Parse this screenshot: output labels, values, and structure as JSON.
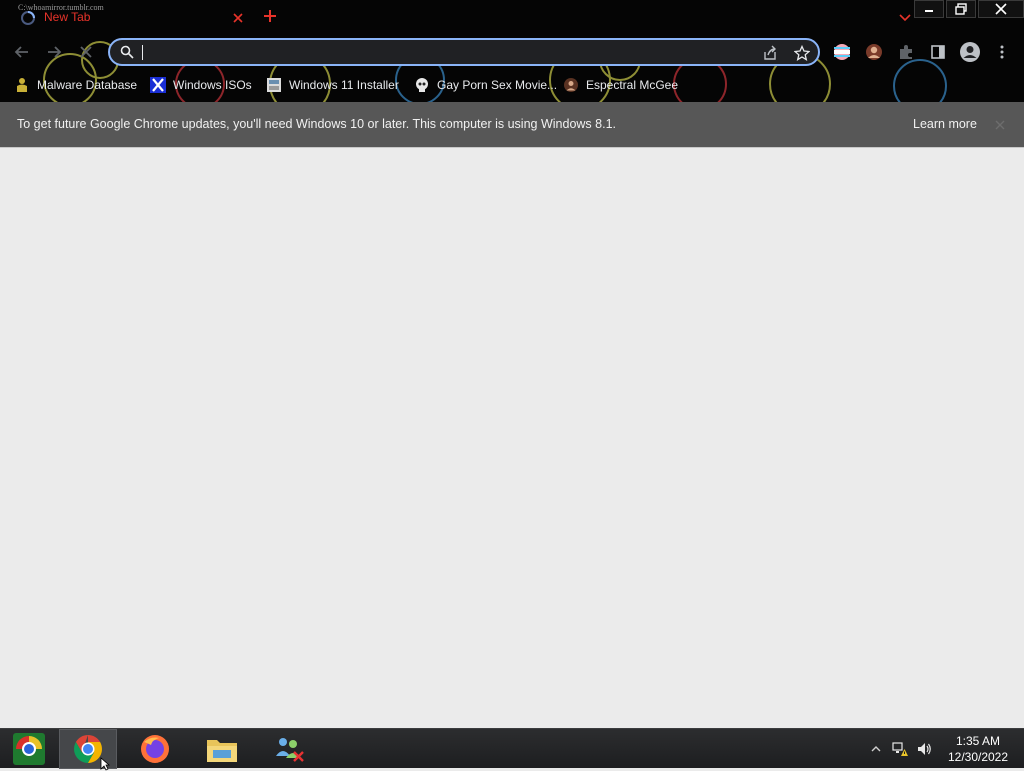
{
  "browser": {
    "tab": {
      "title": "New Tab",
      "tooltip": "C:\\whoamirror.tumblr.com"
    },
    "omnibox": {
      "value": "",
      "placeholder": ""
    }
  },
  "bookmarks": [
    {
      "label": "Malware Database",
      "icon": "yellow-figure-icon"
    },
    {
      "label": "Windows ISOs",
      "icon": "x-logo-icon"
    },
    {
      "label": "Windows 11 Installer",
      "icon": "installer-icon"
    },
    {
      "label": "Gay Porn Sex Movie...",
      "icon": "skull-icon"
    },
    {
      "label": "Espectral McGee",
      "icon": "person-icon"
    }
  ],
  "infobar": {
    "message": "To get future Google Chrome updates, you'll need Windows 10 or later. This computer is using Windows 8.1.",
    "link": "Learn more"
  },
  "taskbar": {
    "apps": [
      "chromium-icon",
      "chrome-icon",
      "firefox-icon",
      "file-explorer-icon",
      "network-people-icon"
    ],
    "clock": {
      "time": "1:35 AM",
      "date": "12/30/2022"
    }
  },
  "colors": {
    "tab_title": "#e8332a",
    "omnibox_border": "#8ab4f8",
    "infobar_bg": "#575757",
    "content_bg": "#ebebeb"
  }
}
